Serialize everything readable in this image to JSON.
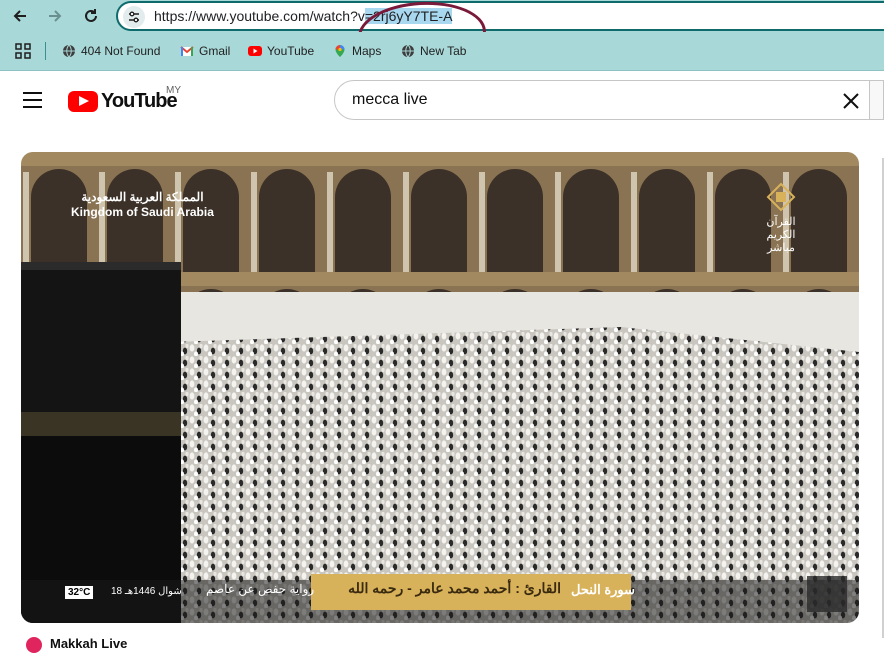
{
  "browser": {
    "url_prefix": "https://www.youtube.com/watch?v",
    "url_selected": "=2rj6yY7TE-A",
    "bookmarks": [
      {
        "label": "404 Not Found",
        "icon": "globe-icon"
      },
      {
        "label": "Gmail",
        "icon": "gmail-icon"
      },
      {
        "label": "YouTube",
        "icon": "youtube-icon"
      },
      {
        "label": "Maps",
        "icon": "maps-pin-icon"
      },
      {
        "label": "New Tab",
        "icon": "globe-icon"
      }
    ]
  },
  "youtube": {
    "logo_text": "YouTube",
    "country_code": "MY",
    "search_query": "mecca live"
  },
  "video": {
    "overlay_top_left_ar": "المملكة العربية السعودية",
    "overlay_top_left_en": "Kingdom of Saudi Arabia",
    "overlay_top_right_ar": "القرآن الكريم",
    "overlay_top_right_sub": "مباشر",
    "temperature": "32°C",
    "date": "18 شوال 1446هـ",
    "narration": "رواية حفص عن عاصم",
    "reciter": "القارئ : أحمد محمد عامر - رحمه الله",
    "surah": "سورة النحل"
  },
  "below_video": {
    "title_fragment": "Makkah Live"
  },
  "colors": {
    "chrome_teal": "#a9d8d8",
    "youtube_red": "#ff0000",
    "annotation": "#7a1a3a"
  }
}
